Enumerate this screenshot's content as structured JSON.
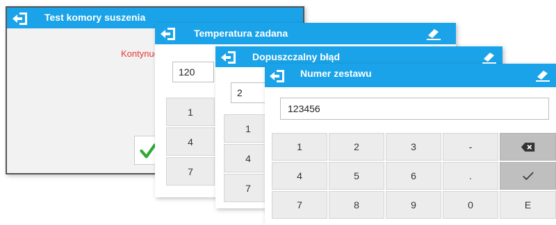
{
  "win1": {
    "title": "Test komory suszenia",
    "message": "Kontynuować?",
    "confirm_icon": "checkmark-icon",
    "icon": "exit-door-icon"
  },
  "win2": {
    "title": "Temperatura zadana",
    "value": "120",
    "keys": [
      "1",
      "4",
      "7"
    ],
    "icon": "exit-door-icon",
    "eraser_icon": "eraser-icon"
  },
  "win3": {
    "title": "Dopuszczalny błąd",
    "value": "2",
    "keys": [
      "1",
      "4",
      "7"
    ],
    "icon": "exit-door-icon",
    "eraser_icon": "eraser-icon"
  },
  "win4": {
    "title": "Numer zestawu",
    "value": "123456",
    "keys": {
      "row1": [
        "1",
        "2",
        "3",
        "-"
      ],
      "row2": [
        "4",
        "5",
        "6",
        "."
      ],
      "row3": [
        "7",
        "8",
        "9",
        "0",
        "E"
      ]
    },
    "backspace_icon": "backspace-icon",
    "ok_icon": "checkmark-icon",
    "icon": "exit-door-icon",
    "eraser_icon": "eraser-icon"
  },
  "colors": {
    "titlebar": "#1aa3e8",
    "message": "#e53935",
    "confirm": "#2eaa34",
    "key": "#ececec",
    "key_dark": "#bfbfbf"
  }
}
